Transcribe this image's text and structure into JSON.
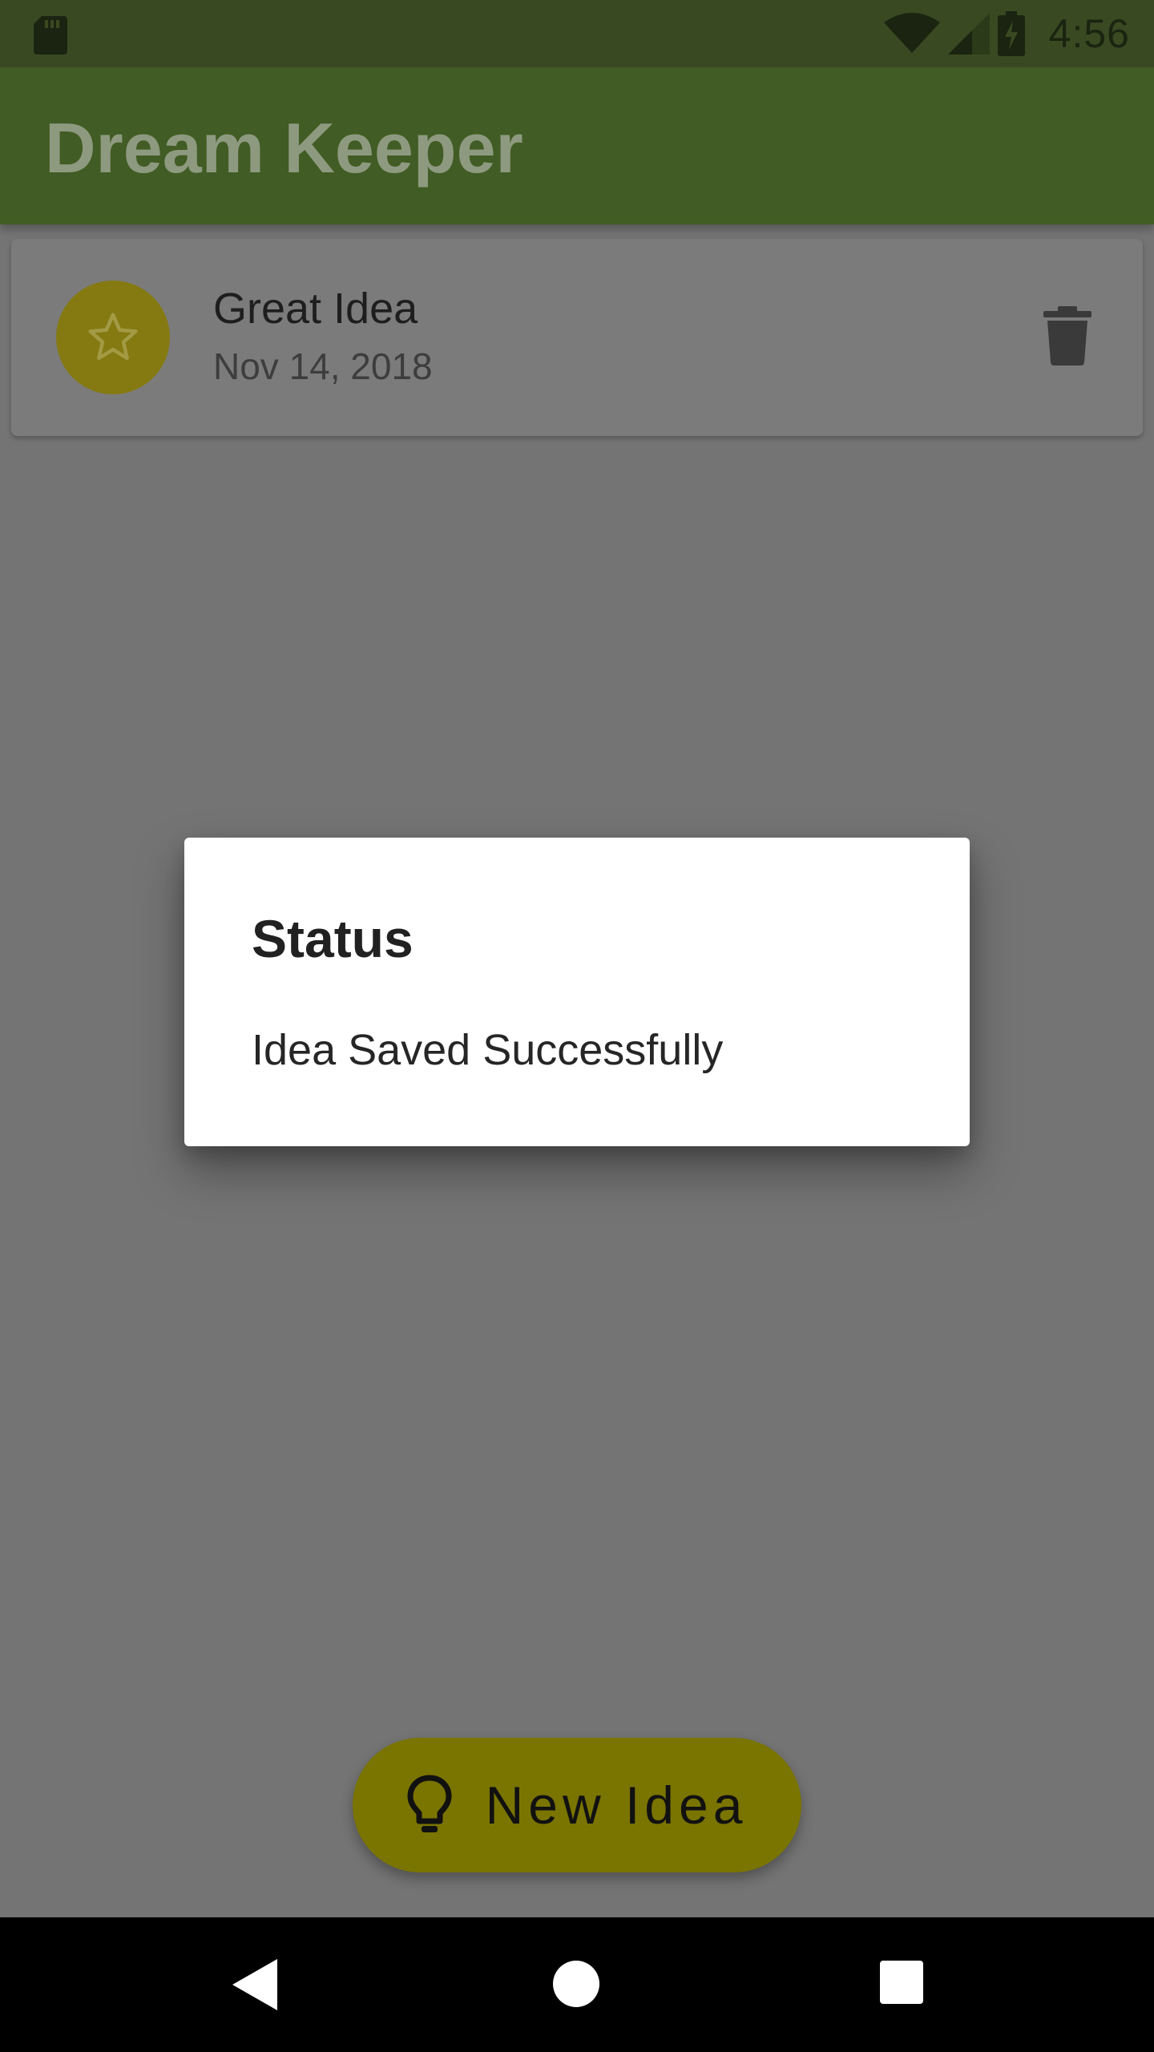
{
  "status_bar": {
    "time": "4:56",
    "icons": [
      "sd-card-icon",
      "wifi-icon",
      "cell-signal-icon",
      "battery-charging-icon"
    ]
  },
  "app_bar": {
    "title": "Dream Keeper",
    "color": "#415c24"
  },
  "ideas": [
    {
      "title": "Great Idea",
      "date": "Nov 14, 2018",
      "icon": "star-icon",
      "avatar_color": "#857a12",
      "action_icon": "trash-icon"
    }
  ],
  "dialog": {
    "title": "Status",
    "message": "Idea Saved Successfully"
  },
  "fab": {
    "label": "New Idea",
    "icon": "lightbulb-icon",
    "color": "#7a7400"
  },
  "nav_bar": {
    "icons": [
      "back-icon",
      "home-icon",
      "recents-icon"
    ]
  }
}
